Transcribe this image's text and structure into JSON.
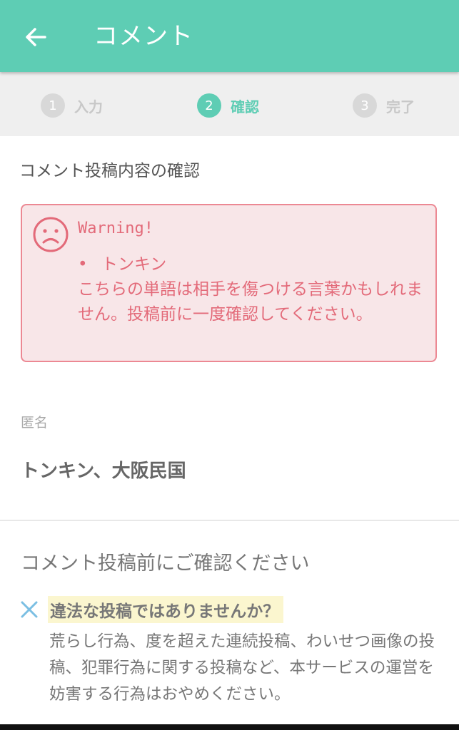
{
  "appbar": {
    "title": "コメント",
    "back_icon": "arrow-left-icon"
  },
  "steps": [
    {
      "num": "1",
      "label": "入力",
      "active": false
    },
    {
      "num": "2",
      "label": "確認",
      "active": true
    },
    {
      "num": "3",
      "label": "完了",
      "active": false
    }
  ],
  "confirm": {
    "section_title": "コメント投稿内容の確認"
  },
  "warning": {
    "icon": "sad-face-icon",
    "title": "Warning!",
    "bullet": "•",
    "word": "トンキン",
    "message": "こちらの単語は相手を傷つける言葉かもしれません。投稿前に一度確認してください。"
  },
  "author": {
    "label": "匿名",
    "value": "トンキン、大阪民国"
  },
  "notice": {
    "title": "コメント投稿前にご確認ください",
    "icon": "x-mark-icon",
    "question": "違法な投稿ではありませんか？",
    "body": "荒らし行為、度を超えた連続投稿、わいせつ画像の投稿、犯罪行為に関する投稿など、本サービスの運営を妨害する行為はおやめください。"
  },
  "colors": {
    "accent": "#5ecdb4",
    "warning": "#e36a79",
    "warning_bg": "#f8e6e8",
    "highlight": "#fbf6cf"
  }
}
